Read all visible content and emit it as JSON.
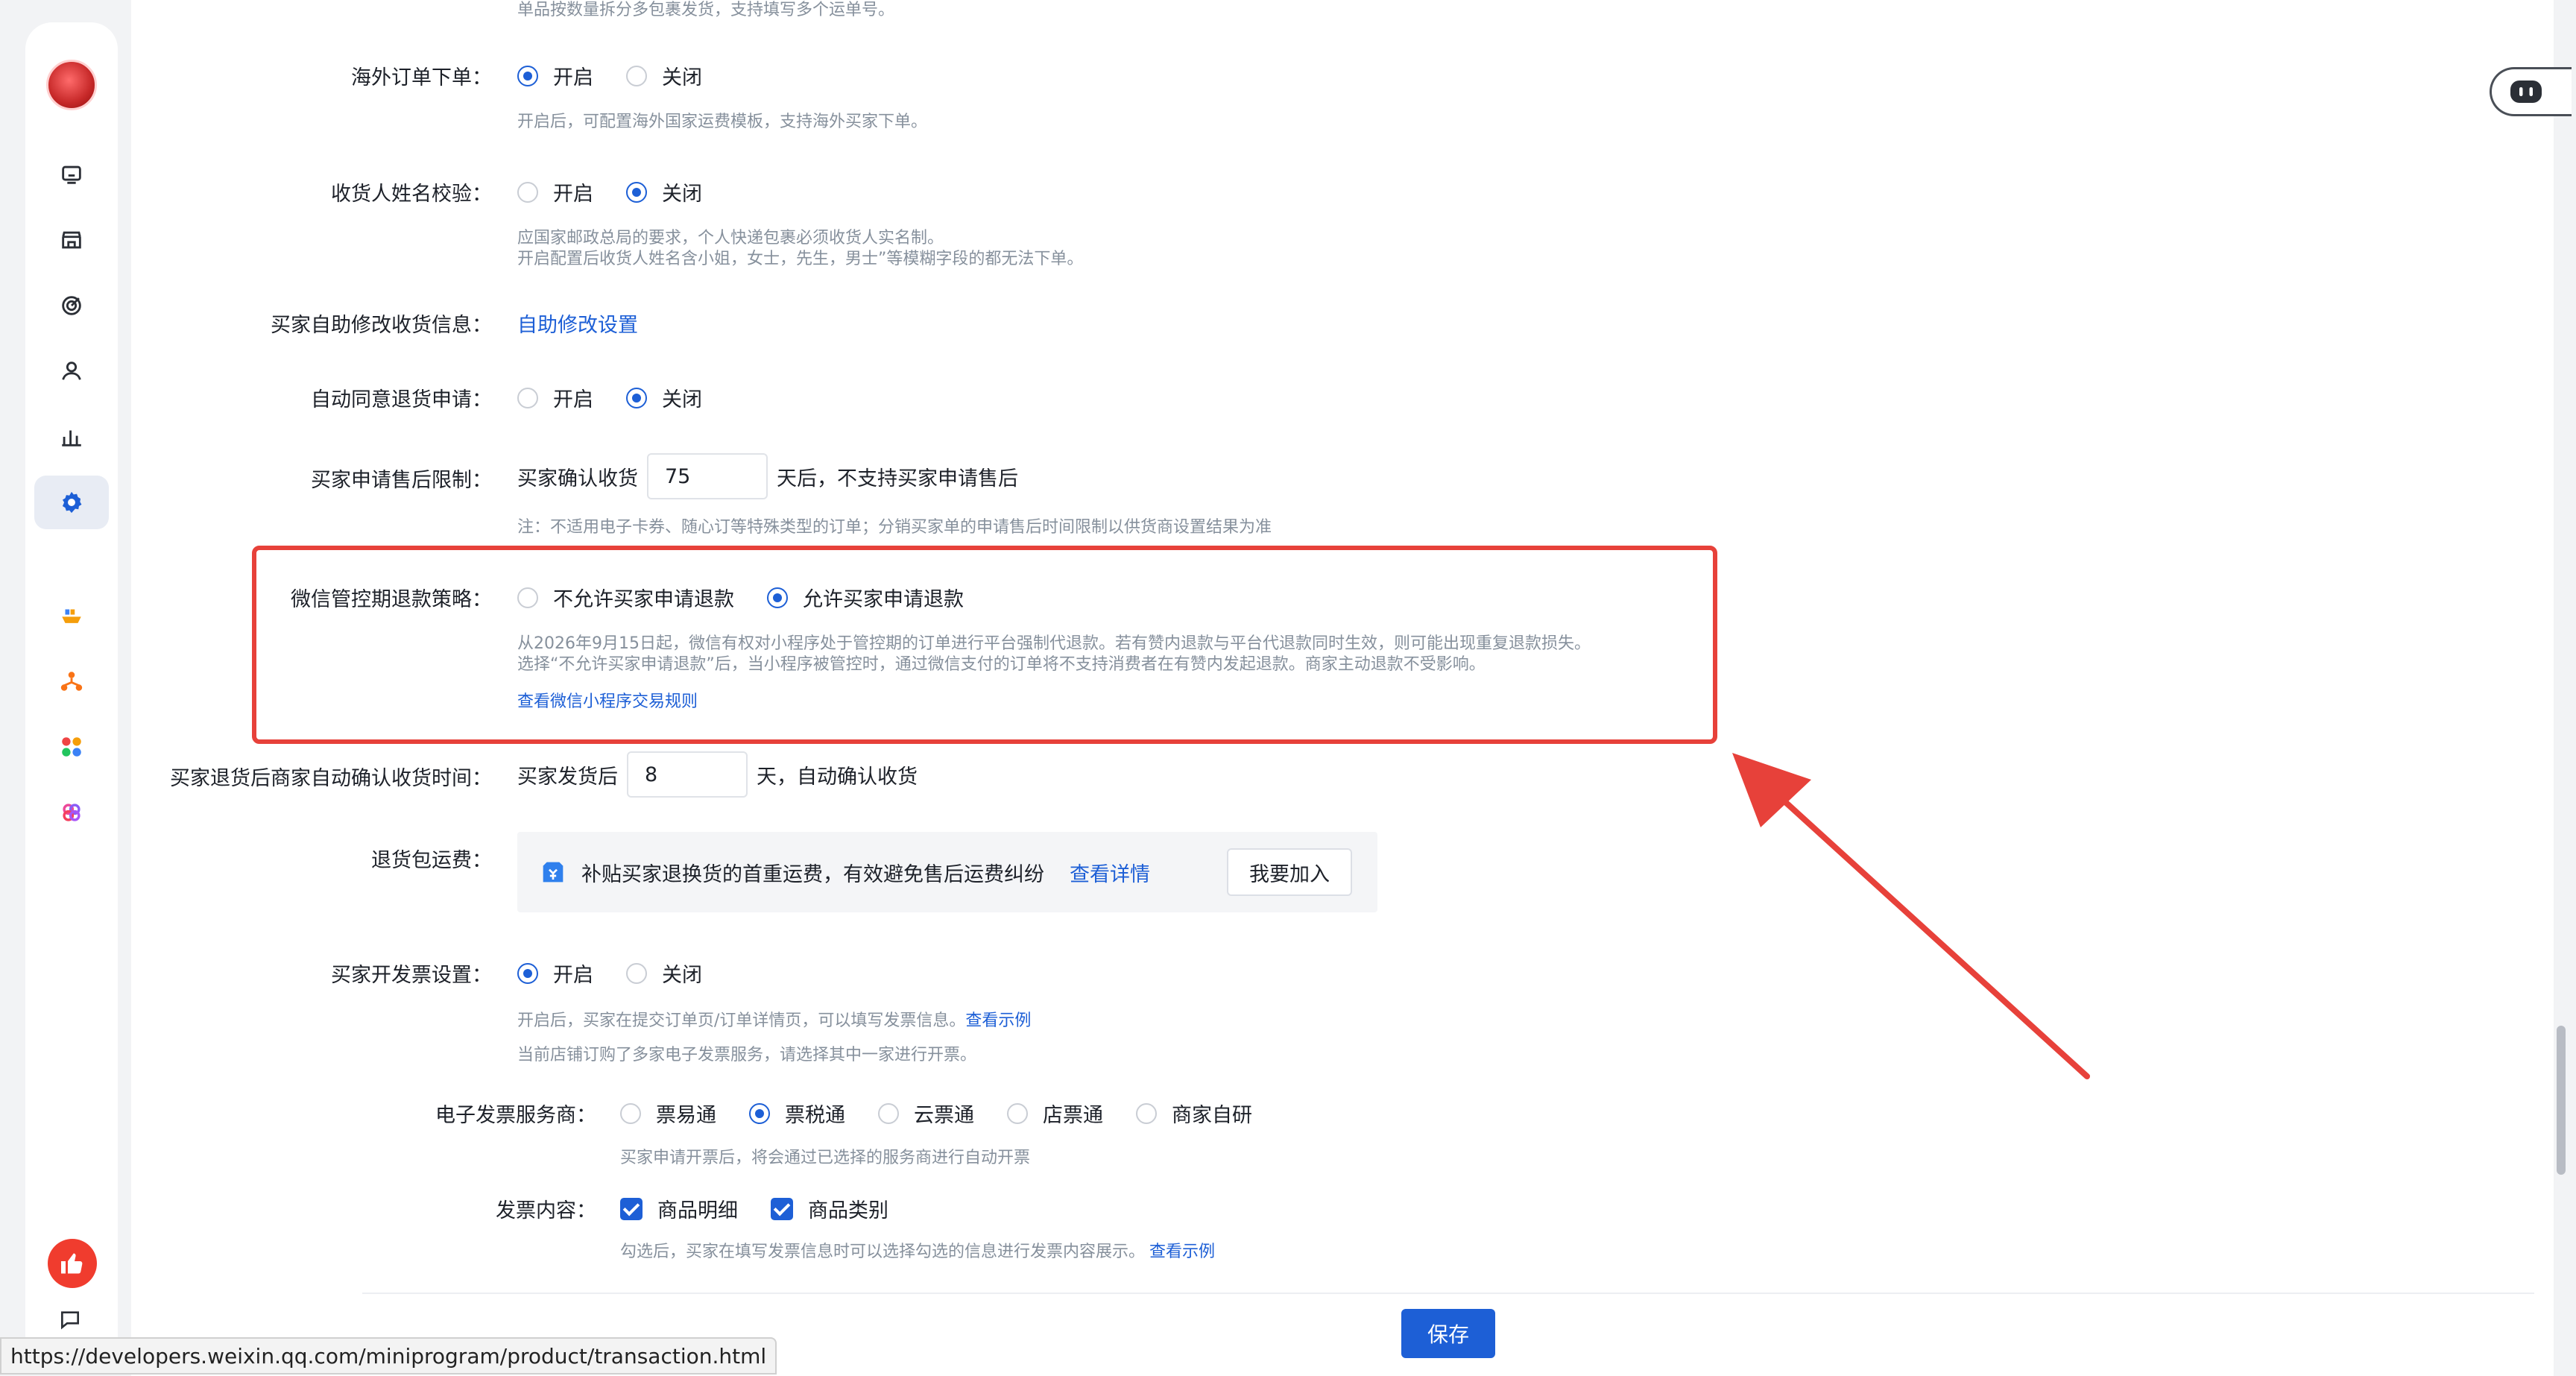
{
  "sidebar": {
    "items": [
      {
        "icon": "assistant-icon"
      },
      {
        "icon": "store-icon"
      },
      {
        "icon": "target-icon"
      },
      {
        "icon": "user-icon"
      },
      {
        "icon": "chart-icon"
      },
      {
        "icon": "settings-icon"
      },
      {
        "icon": "ship-icon"
      },
      {
        "icon": "org-icon"
      },
      {
        "icon": "apps-icon"
      },
      {
        "icon": "plugin-icon"
      }
    ]
  },
  "top_clipped_hint": "单品按数量拆分多包裹发货，支持填写多个运单号。",
  "overseas": {
    "label": "海外订单下单：",
    "opt_on": "开启",
    "opt_off": "关闭",
    "selected": "on",
    "hint": "开启后，可配置海外国家运费模板，支持海外买家下单。"
  },
  "name_check": {
    "label": "收货人姓名校验：",
    "opt_on": "开启",
    "opt_off": "关闭",
    "selected": "off",
    "hint1": "应国家邮政总局的要求，个人快递包裹必须收货人实名制。",
    "hint2": "开启配置后收货人姓名含小姐，女士，先生，男士”等模糊字段的都无法下单。"
  },
  "self_edit": {
    "label": "买家自助修改收货信息：",
    "link": "自助修改设置"
  },
  "auto_return": {
    "label": "自动同意退货申请：",
    "opt_on": "开启",
    "opt_off": "关闭",
    "selected": "off"
  },
  "after_sale": {
    "label": "买家申请售后限制：",
    "prefix": "买家确认收货",
    "value": "75",
    "suffix": "天后，不支持买家申请售后",
    "hint": "注：不适用电子卡券、随心订等特殊类型的订单；分销买家单的申请售后时间限制以供货商设置结果为准"
  },
  "wechat_refund": {
    "label": "微信管控期退款策略：",
    "opt_disallow": "不允许买家申请退款",
    "opt_allow": "允许买家申请退款",
    "selected": "allow",
    "hint1": "从2026年9月15日起，微信有权对小程序处于管控期的订单进行平台强制代退款。若有赞内退款与平台代退款同时生效，则可能出现重复退款损失。",
    "hint2": "选择“不允许买家申请退款”后，当小程序被管控时，通过微信支付的订单将不支持消费者在有赞内发起退款。商家主动退款不受影响。",
    "link": "查看微信小程序交易规则"
  },
  "auto_confirm": {
    "label": "买家退货后商家自动确认收货时间：",
    "prefix": "买家发货后",
    "value": "8",
    "suffix": "天，自动确认收货"
  },
  "return_freight": {
    "label": "退货包运费：",
    "text": "补贴买家退换货的首重运费，有效避免售后运费纠纷",
    "link": "查看详情",
    "button": "我要加入"
  },
  "invoice": {
    "label": "买家开发票设置：",
    "opt_on": "开启",
    "opt_off": "关闭",
    "selected": "on",
    "hint1": "开启后，买家在提交订单页/订单详情页，可以填写发票信息。",
    "hint1_link": "查看示例",
    "hint2": "当前店铺订购了多家电子发票服务，请选择其中一家进行开票。"
  },
  "provider": {
    "label": "电子发票服务商：",
    "options": [
      "票易通",
      "票税通",
      "云票通",
      "店票通",
      "商家自研"
    ],
    "selected_index": 1,
    "hint": "买家申请开票后，将会通过已选择的服务商进行自动开票"
  },
  "invoice_content": {
    "label": "发票内容：",
    "options": [
      "商品明细",
      "商品类别"
    ],
    "hint": "勾选后，买家在填写发票信息时可以选择勾选的信息进行发票内容展示。",
    "hint_link": "查看示例"
  },
  "footer": {
    "save": "保存"
  },
  "status_url": "https://developers.weixin.qq.com/miniprogram/product/transaction.html",
  "colors": {
    "accent": "#1d5fd6",
    "annotation_red": "#e7413a"
  }
}
